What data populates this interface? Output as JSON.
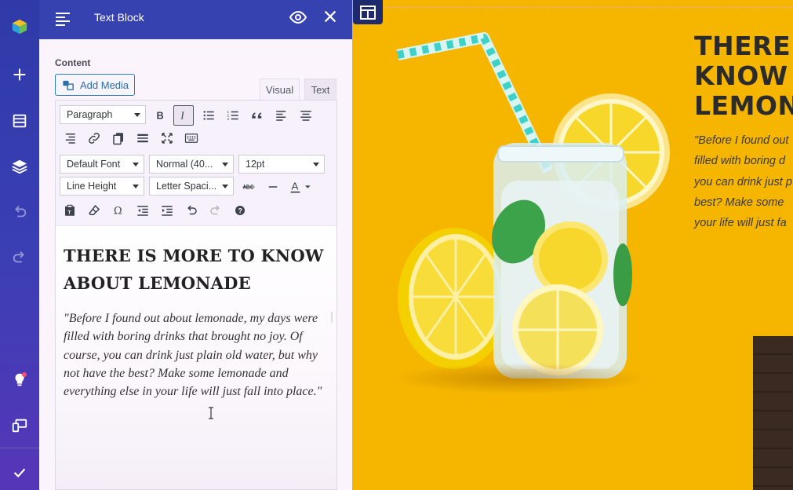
{
  "rail": {
    "icons": [
      "logo-cube-icon",
      "plus-icon",
      "sections-icon",
      "layers-icon",
      "undo-icon",
      "redo-icon",
      "lightbulb-icon",
      "devices-icon",
      "checkmark-icon"
    ]
  },
  "panel": {
    "header": {
      "title": "Text Block"
    },
    "content_label": "Content",
    "add_media_label": "Add Media",
    "tabs": {
      "visual": "Visual",
      "text": "Text"
    },
    "toolbar": {
      "paragraph": "Paragraph",
      "font_family": "Default Font",
      "font_weight": "Normal (40...",
      "font_size": "12pt",
      "line_height": "Line Height",
      "letter_spacing": "Letter Spaci..."
    },
    "editor": {
      "heading": "THERE IS MORE TO KNOW ABOUT LEMONADE",
      "quote": "\"Before I found out about lemonade, my days were filled with boring drinks that brought no joy. Of course, you can drink just plain old water, but why not have the best? Make some lemonade and everything else in your life will just fall into place.\""
    }
  },
  "canvas": {
    "title_lines": [
      "THERE",
      "KNOW",
      "LEMON"
    ],
    "quote_lines": [
      "\"Before I found out",
      "filled with boring d",
      "you can drink just p",
      "best? Make some",
      "your life will just fa"
    ]
  },
  "colors": {
    "accent": "#3742b1",
    "canvas_bg": "#f6b600",
    "straw": "#3fd1c8"
  }
}
